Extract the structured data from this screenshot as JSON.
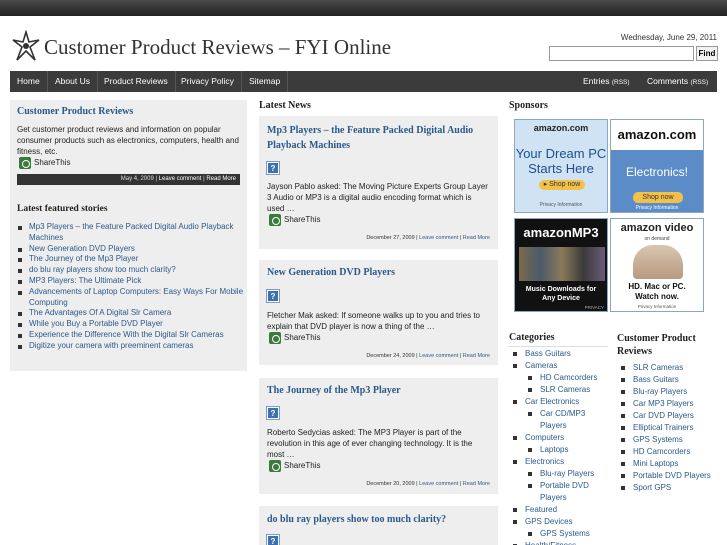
{
  "site": {
    "title": "Customer Product Reviews – FYI Online",
    "date": "Wednesday, June 29, 2011",
    "find_label": "Find"
  },
  "nav": {
    "items": [
      "Home",
      "About Us",
      "Product Reviews",
      "Privacy Policy",
      "Sitemap"
    ],
    "entries": "Entries",
    "comments": "Comments",
    "rss": "(RSS)"
  },
  "about": {
    "title": "Customer Product Reviews",
    "text": "Get customer product reviews and information on popular consumer products such as electronics, computers, health and fitness, etc.",
    "share": "ShareThis",
    "date": "May 4, 2009",
    "leave_comment": "Leave comment",
    "read_more": "Read More"
  },
  "featured": {
    "title": "Latest featured stories",
    "items": [
      "Mp3 Players – the Feature Packed Digital Audio Playback Machines",
      "New Generation DVD Players",
      "The Journey of the Mp3 Player",
      "do blu ray players show too much clarity?",
      "MP3 Players: The Ultimate Pick",
      "Advancements of Laptop Computers: Easy Ways For Mobile Computing",
      "The Advantages Of A Digital Slr Camera",
      "While you Buy a Portable DVD Player",
      "Experience the Difference With the Digital Slr Cameras",
      "Digitize your camera with preeminent cameras"
    ]
  },
  "news": {
    "title": "Latest News",
    "posts": [
      {
        "title": "Mp3 Players – the Feature Packed Digital Audio Playback Machines",
        "text": "Jayson Pablo asked: The Moving Picture Experts Group Layer 3 Audio or MP3 is a digital audio encoding format which is used …",
        "share": "ShareThis",
        "date": "December 27, 2009",
        "leave_comment": "Leave comment",
        "read_more": "Read More"
      },
      {
        "title": "New Generation DVD Players",
        "text": "Fletcher Mak asked: If someone walks up to you and tries to explain that DVD player is now a thing of the …",
        "share": "ShareThis",
        "date": "December 24, 2009",
        "leave_comment": "Leave comment",
        "read_more": "Read More"
      },
      {
        "title": "The Journey of the Mp3 Player",
        "text": "Roberto Sedycias asked: The MP3 Player is part of the revolution in this age of ever changing technology. It is the most …",
        "share": "ShareThis",
        "date": "December 20, 2009",
        "leave_comment": "Leave comment",
        "read_more": "Read More"
      },
      {
        "title": "do blu ray players show too much clarity?"
      }
    ]
  },
  "sponsors": {
    "title": "Sponsors",
    "ads": [
      {
        "brand": "amazon.com",
        "line1": "Your Dream PC",
        "line2": "Starts Here",
        "cta": "▸ Shop now",
        "foot": "Privacy Information"
      },
      {
        "brand": "amazon.com",
        "line1": "Electronics!",
        "cta": "Shop now",
        "foot": "Privacy Information"
      },
      {
        "brand": "amazonMP3",
        "line1": "Music Downloads for",
        "line2": "Any Device",
        "foot": "PRIVACY"
      },
      {
        "brand": "amazon video",
        "sub": "on demand",
        "line1": "HD. Mac or PC.",
        "line2": "Watch now.",
        "foot": "Privacy Information"
      }
    ]
  },
  "categories": {
    "title": "Categories",
    "items": [
      {
        "label": "Bass Guitars",
        "level": 1
      },
      {
        "label": "Cameras",
        "level": 1
      },
      {
        "label": "HD Camcorders",
        "level": 2
      },
      {
        "label": "SLR Cameras",
        "level": 2
      },
      {
        "label": "Car Electronics",
        "level": 1
      },
      {
        "label": "Car CD/MP3",
        "level": 2
      },
      {
        "label": "Players",
        "level": 3
      },
      {
        "label": "Computers",
        "level": 1
      },
      {
        "label": "Laptops",
        "level": 2
      },
      {
        "label": "Electronics",
        "level": 1
      },
      {
        "label": "Blu-ray Players",
        "level": 2
      },
      {
        "label": "Portable DVD",
        "level": 2
      },
      {
        "label": "Players",
        "level": 3
      },
      {
        "label": "Featured",
        "level": 1
      },
      {
        "label": "GPS Devices",
        "level": 1
      },
      {
        "label": "GPS Systems",
        "level": 2
      },
      {
        "label": "Health/Fitness",
        "level": 1
      }
    ]
  },
  "cpr": {
    "title_line1": "Customer Product",
    "title_line2": "Reviews",
    "items": [
      "SLR Cameras",
      "Bass Guitars",
      "Blu-ray Players",
      "Car MP3 Players",
      "Car DVD Players",
      "Elliptical Trainers",
      "GPS Systems",
      "HD Camcorders",
      "Mini Laptops",
      "Portable DVD Players",
      "Sport GPS"
    ]
  }
}
